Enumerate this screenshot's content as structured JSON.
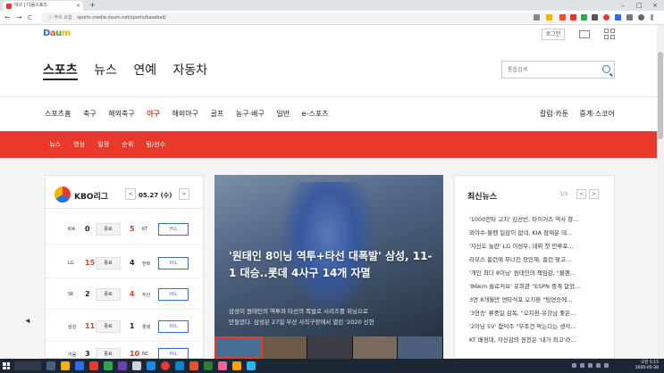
{
  "browser": {
    "tab_title": "야구 | 다음스포츠",
    "tab_close": "×",
    "new_tab": "+",
    "secure_label": "ⓘ 주의 요함",
    "url": "sports.media.daum.net/sports/baseball/",
    "back": "←",
    "forward": "→",
    "reload": "C",
    "minimize": "–",
    "maximize": "□",
    "close": "×"
  },
  "header": {
    "logo": {
      "d": "D",
      "a": "a",
      "u": "u",
      "m": "m"
    },
    "login_label": "로그인",
    "main_nav": [
      "스포츠",
      "뉴스",
      "연예",
      "자동차"
    ],
    "search_placeholder": "통합검색"
  },
  "sub_nav": {
    "items": [
      "스포츠홈",
      "축구",
      "해외축구",
      "야구",
      "해외야구",
      "골프",
      "농구·배구",
      "일반",
      "e-스포츠"
    ],
    "right_items": [
      "칼럼·카툰",
      "중계·스코어"
    ]
  },
  "red_nav": {
    "items": [
      "뉴스",
      "영상",
      "일정",
      "순위",
      "팀/선수"
    ]
  },
  "kbo": {
    "title": "KBO리그",
    "prev": "<",
    "next": ">",
    "date": "05.27 (수)",
    "games": [
      {
        "team1": "KIA",
        "score1": "0",
        "status": "종료",
        "score2": "5",
        "team2": "KT",
        "hl": "H/L"
      },
      {
        "team1": "LG",
        "score1": "15",
        "status": "종료",
        "score2": "4",
        "team2": "한화",
        "hl": "H/L"
      },
      {
        "team1": "SK",
        "score1": "2",
        "status": "종료",
        "score2": "4",
        "team2": "두산",
        "hl": "H/L"
      },
      {
        "team1": "삼성",
        "score1": "11",
        "status": "종료",
        "score2": "1",
        "team2": "롯데",
        "hl": "H/L"
      },
      {
        "team1": "키움",
        "score1": "3",
        "status": "종료",
        "score2": "10",
        "team2": "NC",
        "hl": "H/L"
      }
    ]
  },
  "headline": {
    "title": "'원태인 8이닝 역투+타선 대폭발' 삼성, 11-1 대승..롯데 4사구 14개 자멸",
    "desc_line1": "삼성이 원태인의 역투와 타선의 폭발로 시리즈를 위닝으로",
    "desc_line2": "만들었다. 삼성은 27일 부산 사직구장에서 열린 '2020 신한"
  },
  "news": {
    "title": "최신뉴스",
    "page": "1/3",
    "prev": "<",
    "next": ">",
    "items": [
      "'1000안타 고지' 김선빈, 타이거즈 역사 향...",
      "외야수-불펜 일감이 없네, KIA 잠재운 데...",
      "'자신도 놀란' LG 이성우, 데뷔 첫 만루포...",
      "라모스 홈런에 무너진 장민재, 홈런 맞고...",
      "'개인 최다 8이닝' 원태인의 책임감, \"불펜...",
      "'86km 슬로커브' 유희관 \"ESPN 중계 알았...",
      "3연 8개월만 연타석포 오지환 \"팀연승에...",
      "'3연승' 류중일 감독, \"오지환-유강남 좋은...",
      "'2이닝 5V' 함덕주 \"무조건 막는다는 생각...",
      "KT 배정대, 자신감의 원천은 '내가 최고'라..."
    ]
  },
  "taskbar": {
    "time": "오전 5:15",
    "date": "2020-05-28"
  }
}
